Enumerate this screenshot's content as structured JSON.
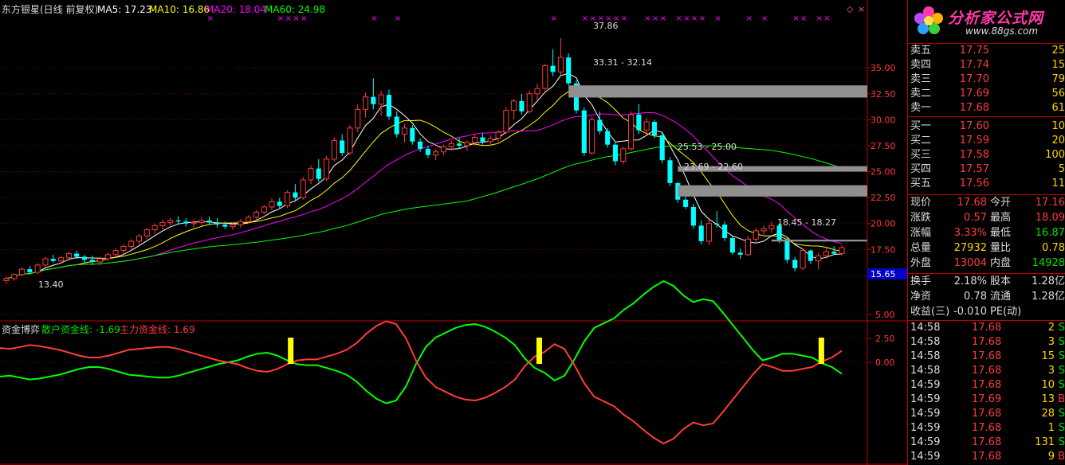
{
  "header": {
    "title": "东方银星(日线 前复权)",
    "ma5": "MA5: 17.23",
    "ma10": "MA10: 16.86",
    "ma20": "MA20: 18.04",
    "ma60": "MA60: 24.98"
  },
  "indicator": {
    "name": "资金博弈",
    "retail": "散户资金线: -1.69",
    "main": "主力资金线: 1.69"
  },
  "price_axis": [
    "35.00",
    "32.50",
    "30.00",
    "27.50",
    "25.00",
    "22.50",
    "20.00",
    "17.50",
    "15.00"
  ],
  "indicator_axis": [
    "5.00",
    "2.50",
    "0.00"
  ],
  "current_price_tag": "15.65",
  "annotations": {
    "high": "37.86",
    "low": "13.40",
    "gap1": "33.31 - 32.14",
    "gap2": "25.53 - 25.00",
    "gap3": "23.69 - 22.60",
    "gap4": "18.45 - 18.27"
  },
  "colors": {
    "up": "#ff3b3b",
    "down": "#00ffff",
    "ma5": "#ffffff",
    "ma10": "#ffff00",
    "ma20": "#ff00ff",
    "ma60": "#00ff00",
    "grid": "#800000"
  },
  "quotes": {
    "asks": [
      {
        "label": "卖五",
        "price": "17.75",
        "vol": "25"
      },
      {
        "label": "卖四",
        "price": "17.74",
        "vol": "15"
      },
      {
        "label": "卖三",
        "price": "17.70",
        "vol": "79"
      },
      {
        "label": "卖二",
        "price": "17.69",
        "vol": "56"
      },
      {
        "label": "卖一",
        "price": "17.68",
        "vol": "61"
      }
    ],
    "bids": [
      {
        "label": "买一",
        "price": "17.60",
        "vol": "10"
      },
      {
        "label": "买二",
        "price": "17.59",
        "vol": "20"
      },
      {
        "label": "买三",
        "price": "17.58",
        "vol": "100"
      },
      {
        "label": "买四",
        "price": "17.57",
        "vol": "5"
      },
      {
        "label": "买五",
        "price": "17.56",
        "vol": "11"
      }
    ]
  },
  "stats": [
    {
      "l1": "现价",
      "v1": "17.68",
      "c1": "red",
      "l2": "今开",
      "v2": "17.16",
      "c2": "red"
    },
    {
      "l1": "涨跌",
      "v1": "0.57",
      "c1": "red",
      "l2": "最高",
      "v2": "18.09",
      "c2": "red"
    },
    {
      "l1": "涨幅",
      "v1": "3.33%",
      "c1": "red",
      "l2": "最低",
      "v2": "16.87",
      "c2": "green"
    },
    {
      "l1": "总量",
      "v1": "27932",
      "c1": "yellow",
      "l2": "量比",
      "v2": "0.78",
      "c2": "yellow"
    },
    {
      "l1": "外盘",
      "v1": "13004",
      "c1": "red",
      "l2": "内盘",
      "v2": "14928",
      "c2": "green"
    }
  ],
  "stats2": [
    {
      "l1": "换手",
      "v1": "2.18%",
      "l2": "股本",
      "v2": "1.28亿"
    },
    {
      "l1": "净资",
      "v1": "0.78",
      "l2": "流通",
      "v2": "1.28亿"
    },
    {
      "l1": "收益(三)",
      "v1": "-0.010",
      "l2": "PE(动)",
      "v2": ""
    }
  ],
  "ticks": [
    {
      "time": "14:58",
      "price": "17.68",
      "vol": "2",
      "dir": "S"
    },
    {
      "time": "14:58",
      "price": "17.68",
      "vol": "3",
      "dir": "S"
    },
    {
      "time": "14:58",
      "price": "17.68",
      "vol": "15",
      "dir": "S"
    },
    {
      "time": "14:58",
      "price": "17.68",
      "vol": "3",
      "dir": "S"
    },
    {
      "time": "14:59",
      "price": "17.68",
      "vol": "10",
      "dir": "S"
    },
    {
      "time": "14:59",
      "price": "17.69",
      "vol": "13",
      "dir": "B"
    },
    {
      "time": "14:59",
      "price": "17.68",
      "vol": "28",
      "dir": "S"
    },
    {
      "time": "14:59",
      "price": "17.68",
      "vol": "1",
      "dir": "S"
    },
    {
      "time": "14:59",
      "price": "17.68",
      "vol": "131",
      "dir": "S"
    },
    {
      "time": "14:59",
      "price": "17.68",
      "vol": "9",
      "dir": "B"
    }
  ],
  "logo": {
    "brand": "分析家公式网",
    "site": "www.88gs.com"
  },
  "chart_data": {
    "type": "candlestick",
    "ylim": [
      13.0,
      40.0
    ],
    "candles": [
      [
        14.5,
        14.9,
        14.2,
        14.7
      ],
      [
        14.7,
        15.2,
        14.5,
        15.1
      ],
      [
        15.1,
        15.8,
        14.9,
        15.6
      ],
      [
        15.6,
        15.9,
        15.1,
        15.3
      ],
      [
        15.3,
        16.2,
        15.1,
        16.0
      ],
      [
        16.0,
        16.8,
        15.8,
        16.6
      ],
      [
        16.6,
        17.0,
        16.2,
        16.4
      ],
      [
        16.4,
        16.9,
        16.1,
        16.7
      ],
      [
        16.7,
        17.3,
        16.4,
        17.1
      ],
      [
        17.1,
        17.4,
        16.6,
        16.8
      ],
      [
        16.8,
        17.0,
        16.2,
        16.5
      ],
      [
        16.5,
        16.9,
        16.0,
        16.3
      ],
      [
        16.3,
        16.8,
        16.0,
        16.6
      ],
      [
        16.6,
        17.2,
        16.4,
        17.0
      ],
      [
        17.0,
        17.6,
        16.8,
        17.4
      ],
      [
        17.4,
        18.0,
        17.1,
        17.8
      ],
      [
        17.8,
        18.5,
        17.5,
        18.3
      ],
      [
        18.3,
        19.0,
        18.0,
        18.8
      ],
      [
        18.8,
        19.6,
        18.5,
        19.4
      ],
      [
        19.4,
        20.0,
        19.0,
        19.8
      ],
      [
        19.8,
        20.4,
        19.4,
        20.1
      ],
      [
        20.1,
        20.6,
        19.8,
        20.3
      ],
      [
        20.3,
        20.7,
        19.9,
        20.2
      ],
      [
        20.2,
        20.5,
        19.7,
        20.0
      ],
      [
        20.0,
        20.4,
        19.6,
        20.1
      ],
      [
        20.1,
        20.6,
        19.8,
        20.3
      ],
      [
        20.3,
        20.7,
        19.9,
        20.1
      ],
      [
        20.1,
        20.5,
        19.6,
        19.9
      ],
      [
        19.9,
        20.2,
        19.5,
        19.7
      ],
      [
        19.7,
        20.1,
        19.4,
        19.9
      ],
      [
        19.9,
        20.4,
        19.6,
        20.2
      ],
      [
        20.2,
        20.8,
        20.0,
        20.6
      ],
      [
        20.6,
        21.3,
        20.4,
        21.1
      ],
      [
        21.1,
        21.8,
        20.9,
        21.6
      ],
      [
        21.6,
        22.4,
        21.3,
        22.1
      ],
      [
        22.1,
        22.5,
        21.4,
        21.7
      ],
      [
        21.7,
        23.2,
        21.5,
        23.0
      ],
      [
        23.0,
        23.8,
        22.2,
        22.5
      ],
      [
        22.5,
        24.5,
        22.3,
        24.2
      ],
      [
        24.2,
        25.6,
        23.8,
        25.3
      ],
      [
        25.3,
        26.2,
        24.0,
        24.3
      ],
      [
        24.3,
        26.5,
        24.1,
        26.2
      ],
      [
        26.2,
        28.3,
        26.0,
        28.0
      ],
      [
        28.0,
        28.6,
        26.5,
        26.8
      ],
      [
        26.8,
        29.5,
        26.6,
        29.2
      ],
      [
        29.2,
        31.5,
        28.8,
        31.0
      ],
      [
        31.0,
        32.6,
        30.2,
        32.2
      ],
      [
        32.2,
        34.0,
        31.0,
        31.5
      ],
      [
        31.5,
        32.8,
        30.4,
        32.4
      ],
      [
        32.4,
        32.9,
        30.0,
        30.3
      ],
      [
        30.3,
        30.8,
        28.3,
        28.6
      ],
      [
        28.6,
        29.6,
        27.8,
        29.2
      ],
      [
        29.2,
        29.5,
        27.6,
        27.9
      ],
      [
        27.9,
        28.2,
        26.9,
        27.2
      ],
      [
        27.2,
        27.5,
        26.3,
        26.6
      ],
      [
        26.6,
        27.2,
        26.1,
        26.9
      ],
      [
        26.9,
        27.6,
        26.6,
        27.4
      ],
      [
        27.4,
        28.0,
        27.0,
        27.7
      ],
      [
        27.7,
        28.3,
        27.2,
        27.5
      ],
      [
        27.5,
        28.0,
        27.0,
        27.8
      ],
      [
        27.8,
        28.6,
        27.5,
        28.3
      ],
      [
        28.3,
        28.7,
        27.6,
        27.9
      ],
      [
        27.9,
        28.5,
        27.5,
        28.2
      ],
      [
        28.2,
        29.0,
        27.9,
        28.8
      ],
      [
        28.8,
        31.2,
        28.6,
        30.9
      ],
      [
        30.9,
        32.0,
        30.0,
        31.8
      ],
      [
        31.8,
        32.5,
        30.5,
        30.8
      ],
      [
        30.8,
        32.8,
        30.6,
        32.5
      ],
      [
        32.5,
        33.5,
        31.8,
        33.0
      ],
      [
        33.0,
        35.4,
        32.8,
        35.2
      ],
      [
        35.2,
        36.8,
        34.2,
        34.6
      ],
      [
        34.6,
        37.86,
        34.3,
        36.0
      ],
      [
        36.0,
        36.4,
        33.3,
        33.5
      ],
      [
        33.5,
        33.8,
        30.6,
        30.9
      ],
      [
        30.9,
        31.2,
        26.5,
        26.8
      ],
      [
        26.8,
        30.3,
        26.6,
        30.0
      ],
      [
        30.0,
        30.8,
        28.6,
        28.9
      ],
      [
        28.9,
        29.2,
        27.3,
        27.6
      ],
      [
        27.6,
        27.9,
        25.6,
        26.0
      ],
      [
        26.0,
        27.4,
        25.7,
        27.2
      ],
      [
        27.2,
        30.8,
        27.0,
        30.5
      ],
      [
        30.5,
        31.5,
        28.6,
        29.0
      ],
      [
        29.0,
        30.2,
        28.5,
        29.8
      ],
      [
        29.8,
        30.0,
        28.2,
        28.5
      ],
      [
        28.5,
        28.7,
        25.8,
        26.1
      ],
      [
        26.1,
        26.4,
        23.6,
        23.9
      ],
      [
        23.9,
        24.0,
        22.0,
        22.3
      ],
      [
        22.3,
        22.6,
        21.4,
        21.6
      ],
      [
        21.6,
        21.9,
        19.5,
        19.8
      ],
      [
        19.8,
        20.3,
        18.0,
        18.3
      ],
      [
        18.3,
        20.3,
        17.9,
        20.0
      ],
      [
        20.0,
        21.2,
        19.6,
        19.9
      ],
      [
        19.9,
        20.2,
        18.3,
        18.6
      ],
      [
        18.6,
        18.8,
        17.0,
        17.2
      ],
      [
        17.2,
        17.6,
        16.6,
        17.0
      ],
      [
        17.0,
        18.8,
        16.9,
        18.5
      ],
      [
        18.5,
        19.6,
        18.2,
        19.3
      ],
      [
        19.3,
        19.8,
        18.8,
        19.5
      ],
      [
        19.5,
        20.2,
        19.1,
        19.8
      ],
      [
        19.8,
        20.0,
        18.1,
        18.3
      ],
      [
        18.3,
        18.6,
        16.2,
        16.5
      ],
      [
        16.5,
        16.8,
        15.4,
        15.7
      ],
      [
        15.7,
        17.6,
        15.5,
        17.4
      ],
      [
        17.4,
        17.5,
        16.1,
        16.4
      ],
      [
        16.4,
        17.2,
        15.6,
        16.9
      ],
      [
        16.9,
        17.6,
        16.6,
        17.3
      ],
      [
        17.3,
        17.8,
        17.0,
        17.1
      ],
      [
        17.1,
        17.9,
        16.87,
        17.68
      ]
    ],
    "retail_line": [
      -1.5,
      -1.4,
      -1.6,
      -1.8,
      -1.7,
      -1.5,
      -1.3,
      -1.0,
      -0.7,
      -0.5,
      -0.5,
      -0.7,
      -1.0,
      -1.3,
      -1.4,
      -1.5,
      -1.6,
      -1.6,
      -1.4,
      -1.1,
      -0.8,
      -0.5,
      -0.2,
      0.0,
      0.2,
      0.6,
      0.9,
      1.0,
      0.7,
      0.2,
      -0.2,
      -0.3,
      -0.3,
      -0.6,
      -0.9,
      -1.3,
      -2.0,
      -3.0,
      -3.8,
      -4.3,
      -4.0,
      -2.5,
      -0.2,
      1.6,
      2.6,
      3.1,
      3.6,
      3.9,
      4.0,
      3.7,
      3.2,
      2.6,
      1.8,
      0.4,
      -0.6,
      -1.1,
      -1.9,
      -1.4,
      0.3,
      2.2,
      3.6,
      4.1,
      4.6,
      5.5,
      6.2,
      7.1,
      7.9,
      8.5,
      8.0,
      7.0,
      6.3,
      6.6,
      6.4,
      5.2,
      3.9,
      2.6,
      1.3,
      0.2,
      0.5,
      0.9,
      0.9,
      0.7,
      0.5,
      -0.1,
      -0.5,
      -1.2
    ],
    "main_line": [
      1.5,
      1.4,
      1.6,
      1.8,
      1.7,
      1.5,
      1.3,
      1.0,
      0.7,
      0.5,
      0.5,
      0.7,
      1.0,
      1.3,
      1.4,
      1.5,
      1.6,
      1.6,
      1.4,
      1.1,
      0.8,
      0.5,
      0.2,
      0.0,
      -0.2,
      -0.6,
      -0.9,
      -1.0,
      -0.7,
      -0.2,
      0.2,
      0.3,
      0.3,
      0.6,
      0.9,
      1.3,
      2.0,
      3.0,
      3.8,
      4.3,
      4.0,
      2.5,
      0.2,
      -1.6,
      -2.6,
      -3.1,
      -3.6,
      -3.9,
      -4.0,
      -3.7,
      -3.2,
      -2.6,
      -1.8,
      -0.4,
      0.6,
      1.1,
      1.9,
      1.4,
      -0.3,
      -2.2,
      -3.6,
      -4.1,
      -4.6,
      -5.5,
      -6.2,
      -7.1,
      -7.9,
      -8.5,
      -8.0,
      -7.0,
      -6.3,
      -6.6,
      -6.4,
      -5.2,
      -3.9,
      -2.6,
      -1.3,
      -0.2,
      -0.5,
      -0.9,
      -0.9,
      -0.7,
      -0.5,
      0.1,
      0.5,
      1.2
    ],
    "signal_bars_at": [
      0.32,
      0.594,
      0.905
    ]
  }
}
